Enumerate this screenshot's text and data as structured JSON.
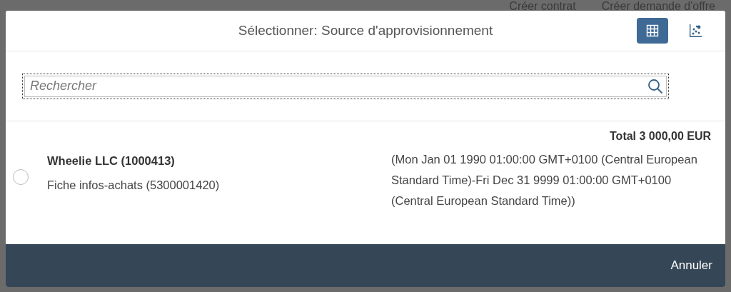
{
  "background_actions": [
    "Créer contrat",
    "Créer demande d'offre"
  ],
  "dialog": {
    "title": "Sélectionner: Source d'approvisionnement",
    "view_buttons": [
      {
        "kind": "table",
        "selected": true
      },
      {
        "kind": "chart",
        "selected": false
      }
    ],
    "search": {
      "placeholder": "Rechercher"
    },
    "total": "Total 3 000,00 EUR",
    "items": [
      {
        "selected": false,
        "name": "Wheelie LLC (1000413)",
        "detail": "Fiche infos-achats (5300001420)",
        "validity": "(Mon Jan 01 1990 01:00:00 GMT+0100 (Central European Standard Time)-Fri Dec 31 9999 01:00:00 GMT+0100 (Central European Standard Time))"
      }
    ],
    "footer_buttons": [
      "Annuler"
    ]
  }
}
